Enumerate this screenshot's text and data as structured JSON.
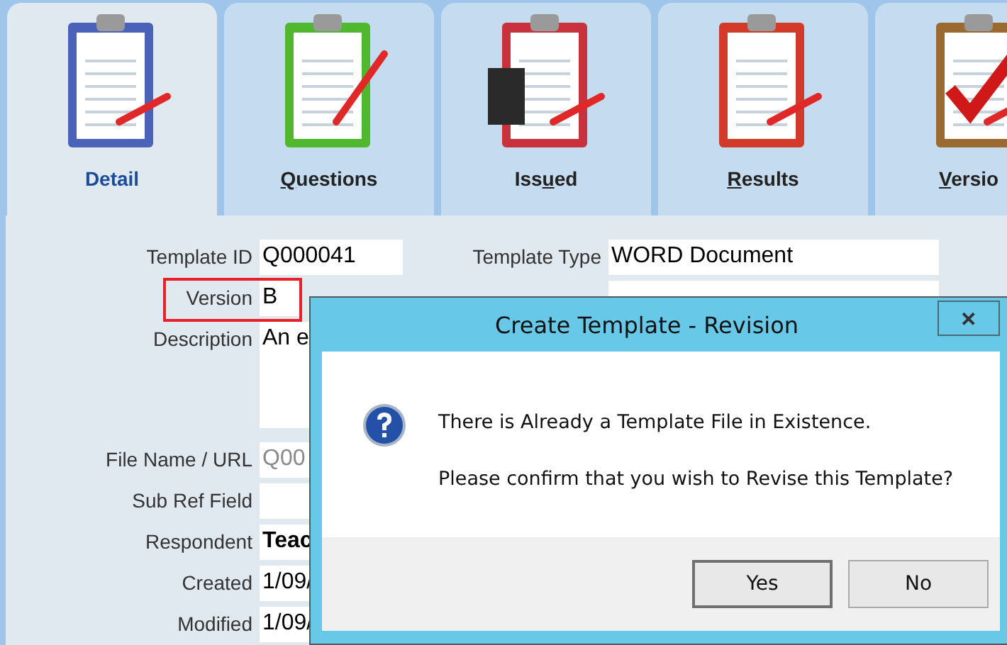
{
  "tabs": [
    {
      "label": {
        "pre": "Detail"
      },
      "selected": true
    },
    {
      "label": {
        "key": "Q",
        "post": "uestions"
      },
      "selected": false
    },
    {
      "label": {
        "pre": "Iss",
        "key": "u",
        "post": "ed"
      },
      "selected": false
    },
    {
      "label": {
        "key": "R",
        "post": "esults"
      },
      "selected": false
    },
    {
      "label": {
        "key": "V",
        "post": "ersio"
      },
      "selected": false
    }
  ],
  "left_fields": [
    {
      "label": "Template ID",
      "value": "Q000041",
      "highlighted": false,
      "disabled": false,
      "bold": false,
      "kind": "short"
    },
    {
      "label": "Version",
      "value": "B",
      "highlighted": true,
      "disabled": false,
      "bold": false,
      "kind": "tiny"
    },
    {
      "label": "Description",
      "value": "An e",
      "highlighted": false,
      "disabled": false,
      "bold": false,
      "kind": "multiline"
    },
    {
      "label": "File Name / URL",
      "value": "Q00",
      "highlighted": false,
      "disabled": true,
      "bold": false,
      "kind": "wide"
    },
    {
      "label": "Sub Ref Field",
      "highlighted": false,
      "kind": "wide"
    },
    {
      "label": "Respondent",
      "value": "Teac",
      "highlighted": false,
      "disabled": false,
      "bold": true,
      "kind": "wide"
    },
    {
      "label": "Created",
      "value": "1/09/",
      "highlighted": false,
      "disabled": false,
      "bold": false,
      "kind": "wide"
    },
    {
      "label": "Modified",
      "value": "1/09/",
      "highlighted": false,
      "disabled": false,
      "bold": false,
      "kind": "wide"
    }
  ],
  "right_fields": [
    {
      "label": "Template Type",
      "value": "WORD Document"
    }
  ],
  "dialog": {
    "title": "Create Template - Revision",
    "close": "✕",
    "lines": [
      "There is Already a Template File in Existence.",
      "Please confirm that you wish to Revise this Template?"
    ],
    "buttons": [
      "Yes",
      "No"
    ]
  }
}
